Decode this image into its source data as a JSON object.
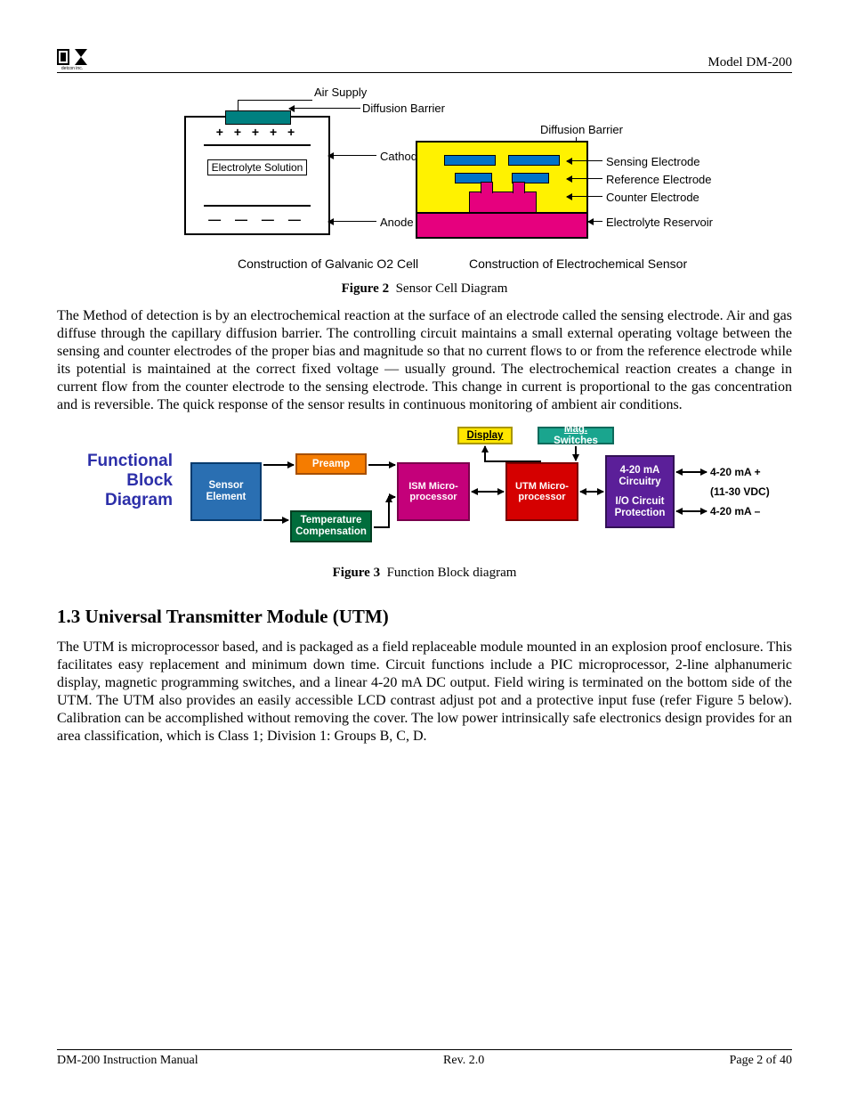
{
  "header": {
    "logo_caption": "detcon inc.",
    "model": "Model DM-200"
  },
  "fig2": {
    "top_labels": {
      "air_supply": "Air Supply",
      "diffusion_barrier_left": "Diffusion Barrier",
      "diffusion_barrier_right": "Diffusion Barrier"
    },
    "left_cell": {
      "cathode": "Cathode",
      "electrolyte": "Electrolyte Solution",
      "anode": "Anode",
      "sub": "Construction of Galvanic O2 Cell"
    },
    "right_cell": {
      "sensing": "Sensing Electrode",
      "reference": "Reference Electrode",
      "counter": "Counter Electrode",
      "reservoir": "Electrolyte Reservoir",
      "sub": "Construction of Electrochemical Sensor"
    },
    "caption_b": "Figure 2",
    "caption_t": "Sensor Cell Diagram"
  },
  "para1": "The Method of detection is by an electrochemical reaction at the surface of an electrode called the sensing electrode.  Air and gas diffuse through the capillary diffusion barrier.  The controlling circuit maintains a small external operating voltage between the sensing and counter electrodes of the proper bias and magnitude so that no current flows to or from the reference electrode while its potential is maintained at the correct fixed voltage — usually ground.  The electrochemical reaction creates a change in current flow from the counter electrode to the sensing electrode.  This change in current is proportional to the gas concentration and is reversible.  The quick response of the sensor results in continuous monitoring of ambient air conditions.",
  "fig3": {
    "title": "Functional Block Diagram",
    "blocks": {
      "sensor": "Sensor Element",
      "preamp": "Preamp",
      "temp": "Temperature Compensation",
      "ism": "ISM Micro-processor",
      "utm": "UTM Micro-processor",
      "display": "Display",
      "mag": "Mag. Switches",
      "io_top": "4-20 mA Circuitry",
      "io_bot": "I/O Circuit Protection"
    },
    "right_labels": {
      "l1": "4-20 mA +",
      "l2": "(11-30 VDC)",
      "l3": "4-20 mA –"
    },
    "caption_b": "Figure 3",
    "caption_t": "Function Block diagram"
  },
  "section": {
    "title": "1.3   Universal Transmitter Module (UTM)"
  },
  "para2": "The UTM is microprocessor based, and is packaged as a field replaceable module mounted in an explosion proof enclosure.  This facilitates easy replacement and minimum down time.  Circuit functions include a PIC microprocessor, 2-line alphanumeric display, magnetic programming switches, and a linear 4-20 mA DC output.  Field wiring is terminated on the bottom side of the UTM.  The UTM also provides an easily accessible LCD contrast adjust pot and a protective input fuse (refer Figure 5 below).  Calibration can be accomplished without removing the cover.  The low power intrinsically safe electronics design provides for an area classification, which is Class 1; Division 1: Groups B, C, D.",
  "footer": {
    "left": "DM-200 Instruction Manual",
    "center": "Rev. 2.0",
    "right": "Page 2 of 40"
  }
}
